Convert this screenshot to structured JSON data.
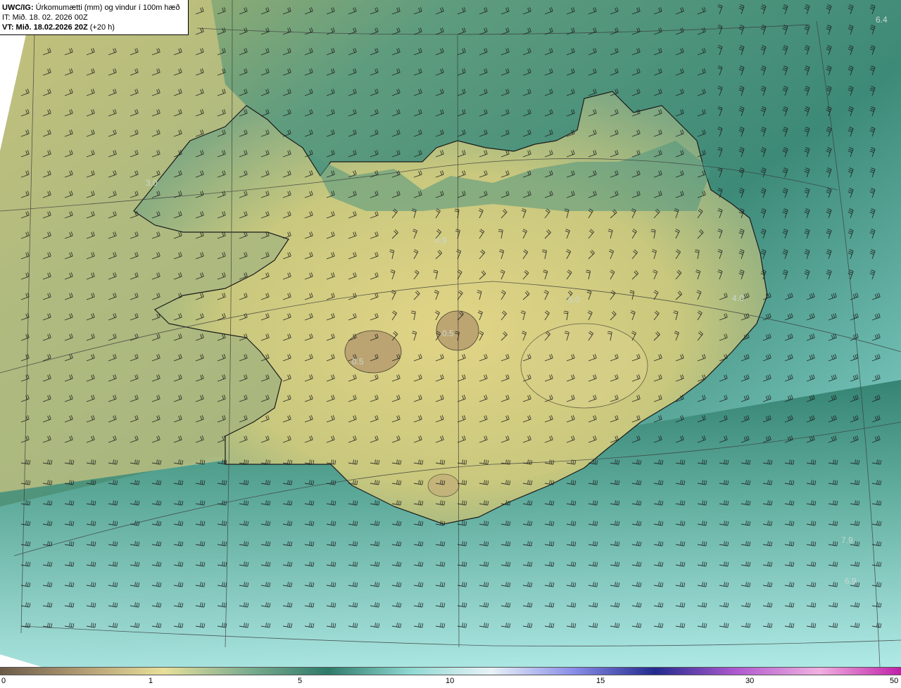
{
  "header": {
    "product": "UWC/IG:",
    "description": "Úrkomumætti (mm) og vindur í 100m hæð",
    "init_time": "IT: Mið. 18. 02. 2026 00Z",
    "valid_label": "VT: Mið. 18.02.2026 20Z",
    "lead": "(+20 h)"
  },
  "map_labels": [
    "6.4",
    "3.0",
    "4.9",
    "5.0",
    "4.0",
    "0.5",
    "0.5",
    "7.9",
    "6.9"
  ],
  "colorbar": {
    "ticks": [
      "0",
      "1",
      "5",
      "10",
      "15",
      "30",
      "50"
    ],
    "colors": [
      "#6b5a48",
      "#b39c73",
      "#e8e09a",
      "#7fae90",
      "#2e7a6a",
      "#8fd8d2",
      "#e8f2f6",
      "#8a8ee8",
      "#222a8e",
      "#b05ad0",
      "#f0b0e0",
      "#c020a8"
    ]
  },
  "palette": {
    "land_yellow": "#e6dc8c",
    "sea_teal": "#3e8c7c",
    "sea_light": "#9ad8d4",
    "coast": "#1a1a1a"
  }
}
